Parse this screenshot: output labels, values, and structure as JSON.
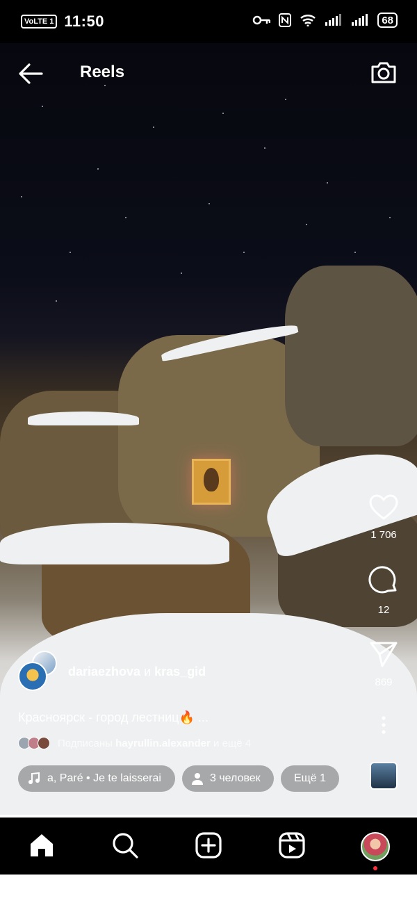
{
  "status_bar": {
    "volte_label": "VoLTE",
    "time": "11:50",
    "battery": "68",
    "icons": [
      "key-icon",
      "nfc-icon",
      "wifi-icon",
      "signal-icon",
      "signal-icon",
      "battery-icon"
    ]
  },
  "header": {
    "title": "Reels",
    "back_icon": "arrow-left-icon",
    "camera_icon": "camera-icon"
  },
  "actions": {
    "likes": "1 706",
    "comments": "12",
    "shares": "869"
  },
  "post": {
    "author_primary": "dariaezhova",
    "connector": "и",
    "author_secondary": "kras_gid",
    "caption": "Красноярск - город лестниц🔥 ...",
    "followers_prefix": "Подписаны",
    "followers_user": "hayrullin.alexander",
    "followers_suffix": "и ещё 4"
  },
  "pills": {
    "music": "а, Paré  •  Je te laisserai",
    "people": "3 человек",
    "more": "Ещё 1"
  },
  "playback": {
    "progress": 0.6
  },
  "nav": {
    "items": [
      "home-icon",
      "search-icon",
      "create-icon",
      "reels-icon",
      "profile-avatar"
    ]
  },
  "colors": {
    "notification": "#ff3040",
    "bars": "#000000"
  }
}
